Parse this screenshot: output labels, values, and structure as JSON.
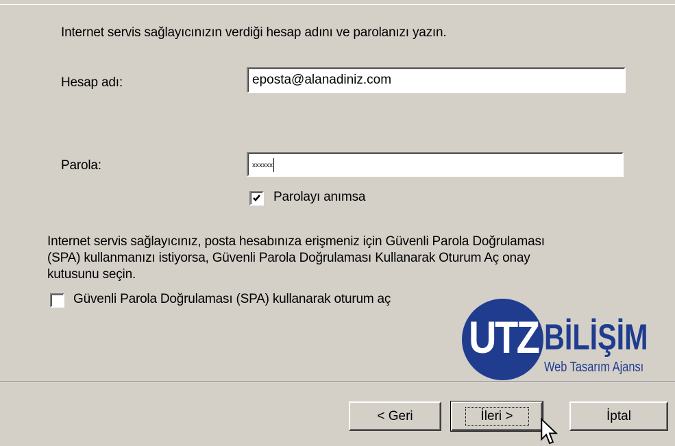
{
  "instruction": "Internet servis sağlayıcınızın verdiği hesap adını ve parolanızı yazın.",
  "account": {
    "label": "Hesap adı:",
    "value": "eposta@alanadiniz.com"
  },
  "password": {
    "label": "Parola:",
    "value": "xxxxxx"
  },
  "remember": {
    "label": "Parolayı anımsa",
    "checked": true
  },
  "spa": {
    "info_line1": "Internet servis sağlayıcınız, posta hesabınıza erişmeniz için Güvenli Parola Doğrulaması",
    "info_line2": "(SPA) kullanmanızı istiyorsa, Güvenli Parola Doğrulaması Kullanarak Oturum Aç onay",
    "info_line3": "kutusunu seçin.",
    "checkbox_label": "Güvenli Parola Doğrulaması (SPA) kullanarak oturum aç",
    "checked": false
  },
  "logo": {
    "part1": "UTZ",
    "part2": "BİLİŞİM",
    "tagline": "Web Tasarım Ajansı",
    "color": "#1f3c8f"
  },
  "buttons": {
    "back": "< Geri",
    "next": "İleri >",
    "cancel": "İptal"
  }
}
